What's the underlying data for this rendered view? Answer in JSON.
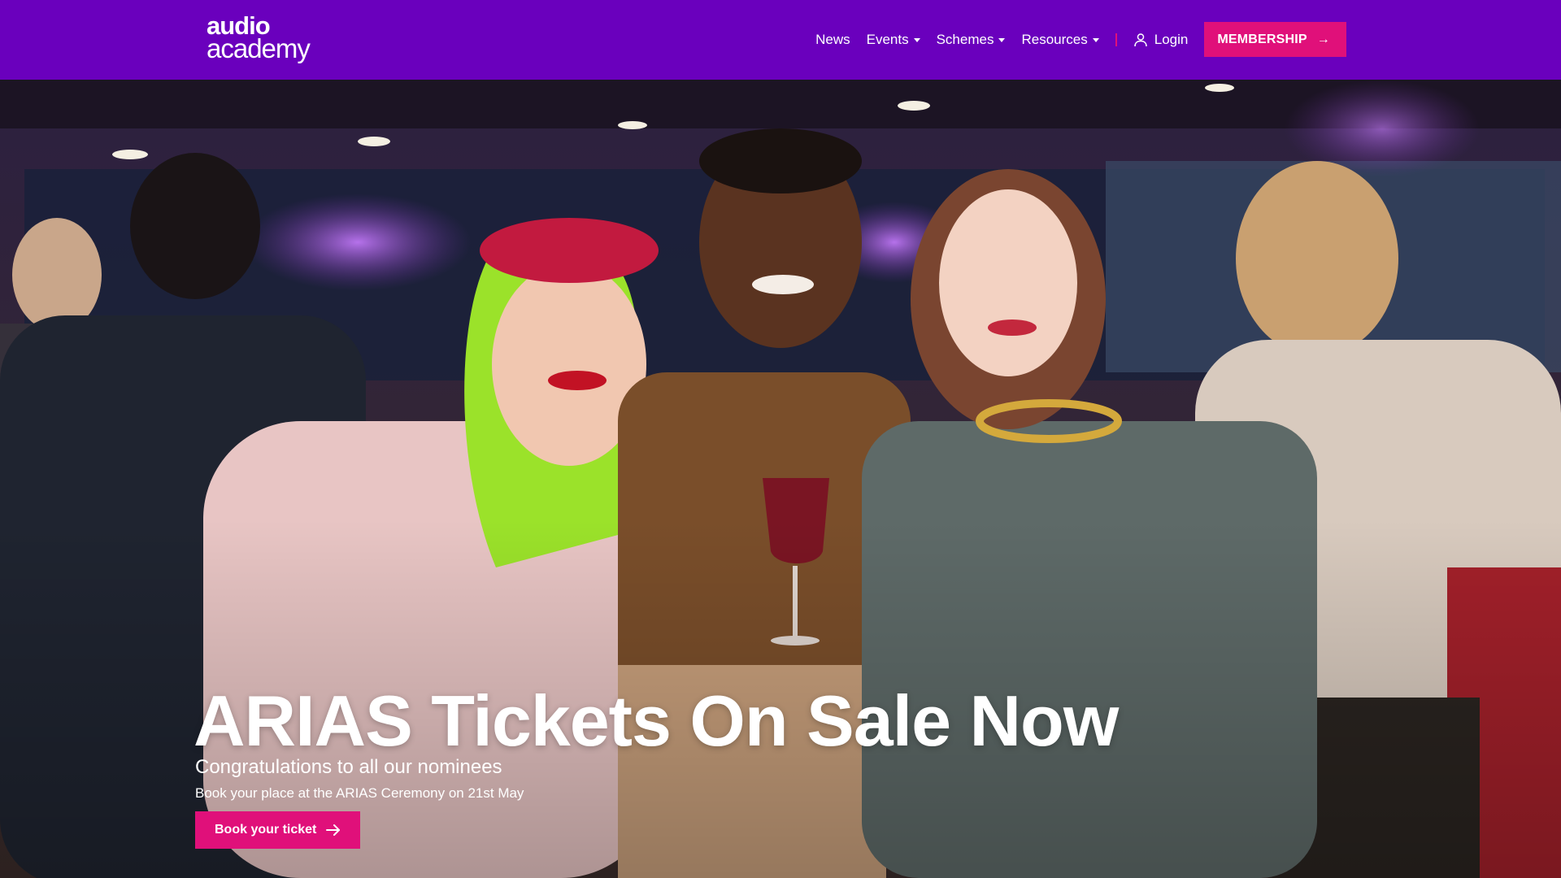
{
  "logo": {
    "line1": "audio",
    "line2": "academy"
  },
  "nav": {
    "items": [
      {
        "label": "News",
        "dropdown": false
      },
      {
        "label": "Events",
        "dropdown": true
      },
      {
        "label": "Schemes",
        "dropdown": true
      },
      {
        "label": "Resources",
        "dropdown": true
      }
    ],
    "login_label": "Login",
    "login_icon": "user-icon",
    "membership_label": "MEMBERSHIP",
    "membership_arrow": "→"
  },
  "hero": {
    "title": "ARIAS Tickets On Sale Now",
    "subtitle": "Congratulations to all our nominees",
    "description": "Book your place at the ARIAS Ceremony on 21st May",
    "button_label": "Book your ticket",
    "button_icon": "arrow-right-icon",
    "image_alt": "Three smiling women posing together at an event"
  },
  "colors": {
    "header_bg": "#6a00bd",
    "accent": "#e0107a",
    "text": "#ffffff"
  }
}
